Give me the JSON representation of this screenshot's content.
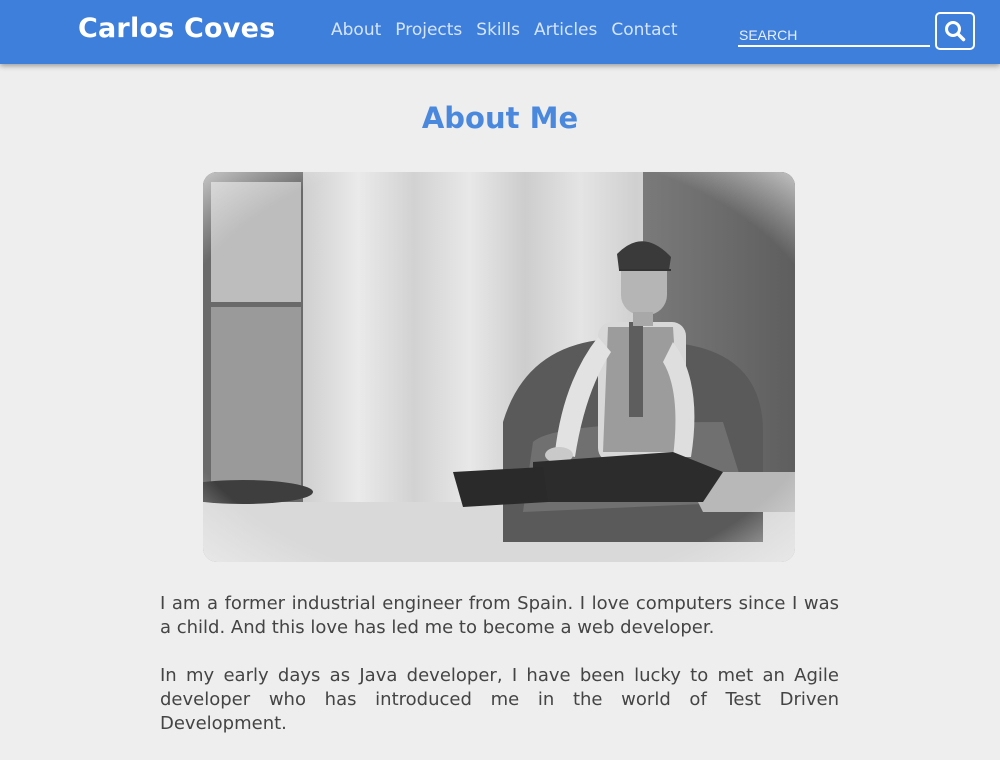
{
  "header": {
    "brand": "Carlos Coves",
    "nav": [
      {
        "label": "About"
      },
      {
        "label": "Projects"
      },
      {
        "label": "Skills"
      },
      {
        "label": "Articles"
      },
      {
        "label": "Contact"
      }
    ],
    "search": {
      "placeholder": "SEARCH",
      "value": "",
      "icon": "search-icon"
    }
  },
  "main": {
    "title": "About Me",
    "photo": {
      "icon": "profile-photo",
      "style": "black-and-white"
    },
    "paragraphs": [
      "I am a former industrial engineer from Spain. I love computers since I was a child. And this love has led me to become a web developer.",
      "In my early days as Java developer, I have been lucky to met an Agile developer who has introduced me in the world of Test Driven Development."
    ]
  },
  "colors": {
    "navbar": "#3d7fdb",
    "title": "#4a88de",
    "background": "#eeeeee",
    "text": "#444444"
  }
}
